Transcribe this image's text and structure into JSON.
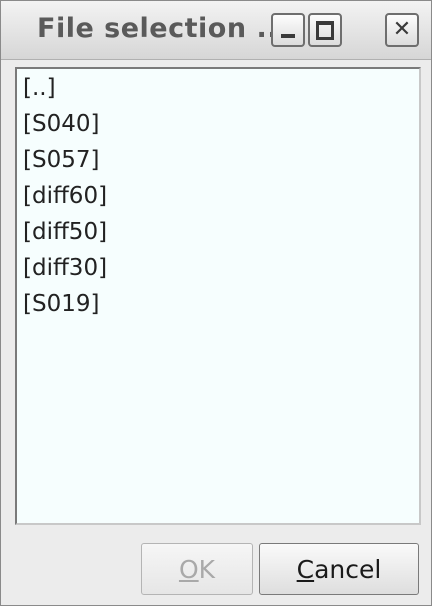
{
  "window": {
    "title": "File selection ...",
    "controls": {
      "minimize_icon": "minimize-icon",
      "maximize_icon": "maximize-icon",
      "close_icon": "close-icon"
    }
  },
  "file_list": {
    "items": [
      "[..]",
      "[S040]",
      "[S057]",
      "[diff60]",
      "[diff50]",
      "[diff30]",
      "[S019]"
    ]
  },
  "buttons": {
    "ok": {
      "mnemonic": "O",
      "rest": "K",
      "enabled": false
    },
    "cancel": {
      "mnemonic": "C",
      "rest": "ancel",
      "enabled": true
    }
  },
  "colors": {
    "list_background": "#f6fefe",
    "disabled_text": "#a9a9a9"
  }
}
